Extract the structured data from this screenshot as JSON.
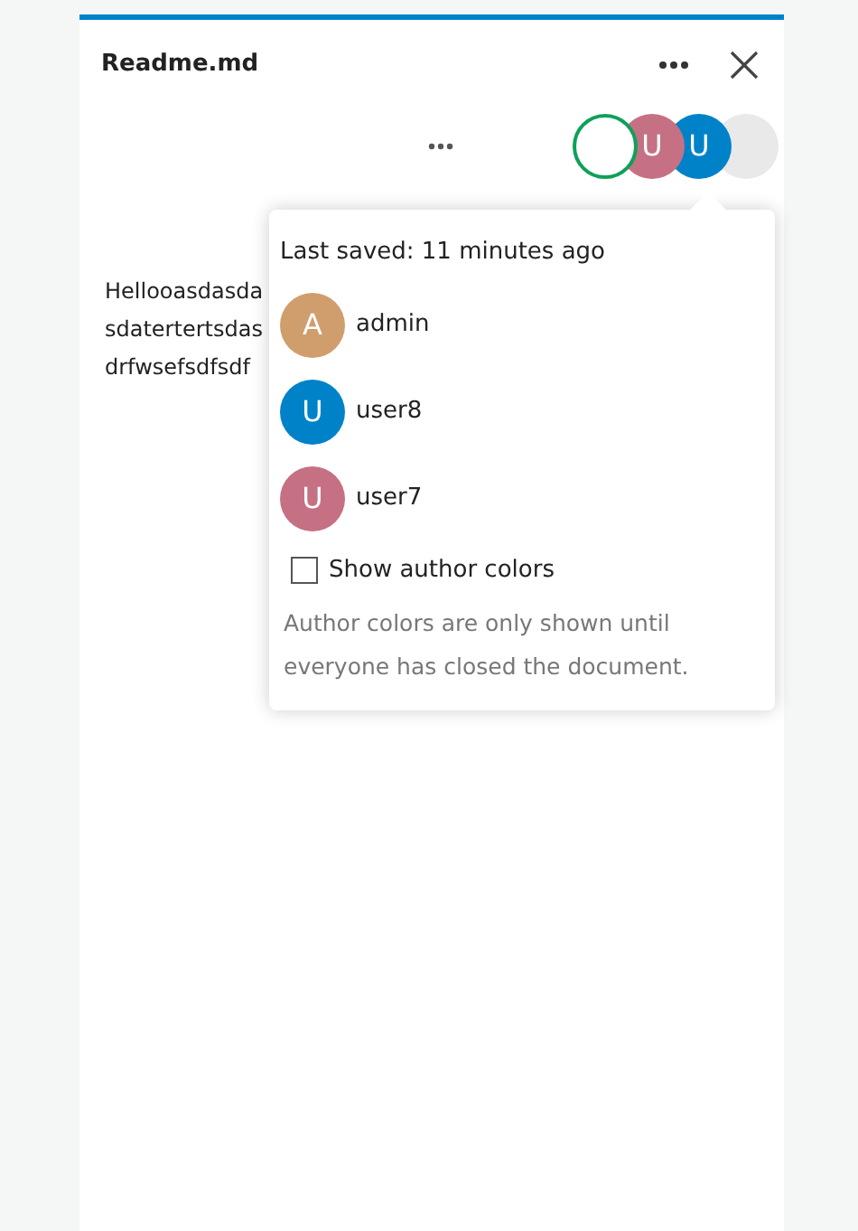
{
  "window": {
    "title": "Readme.md"
  },
  "session_avatars": [
    {
      "kind": "self",
      "color": "#0ea05a"
    },
    {
      "kind": "user",
      "letter": "U",
      "color": "#c57183"
    },
    {
      "kind": "user",
      "letter": "U",
      "color": "#0082c9"
    },
    {
      "kind": "more",
      "color": "#e9e9e9"
    }
  ],
  "document": {
    "lines": [
      "Hellooasdasda",
      "sdatertertsdas",
      "drfwsefsdfsdf"
    ]
  },
  "popover": {
    "last_saved": "Last saved: 11 minutes ago",
    "users": [
      {
        "letter": "A",
        "name": "admin",
        "color": "#d09e6d"
      },
      {
        "letter": "U",
        "name": "user8",
        "color": "#0082c9"
      },
      {
        "letter": "U",
        "name": "user7",
        "color": "#c57183"
      }
    ],
    "show_author_colors": {
      "label": "Show author colors",
      "checked": false
    },
    "hint": "Author colors are only shown until everyone has closed the document."
  }
}
